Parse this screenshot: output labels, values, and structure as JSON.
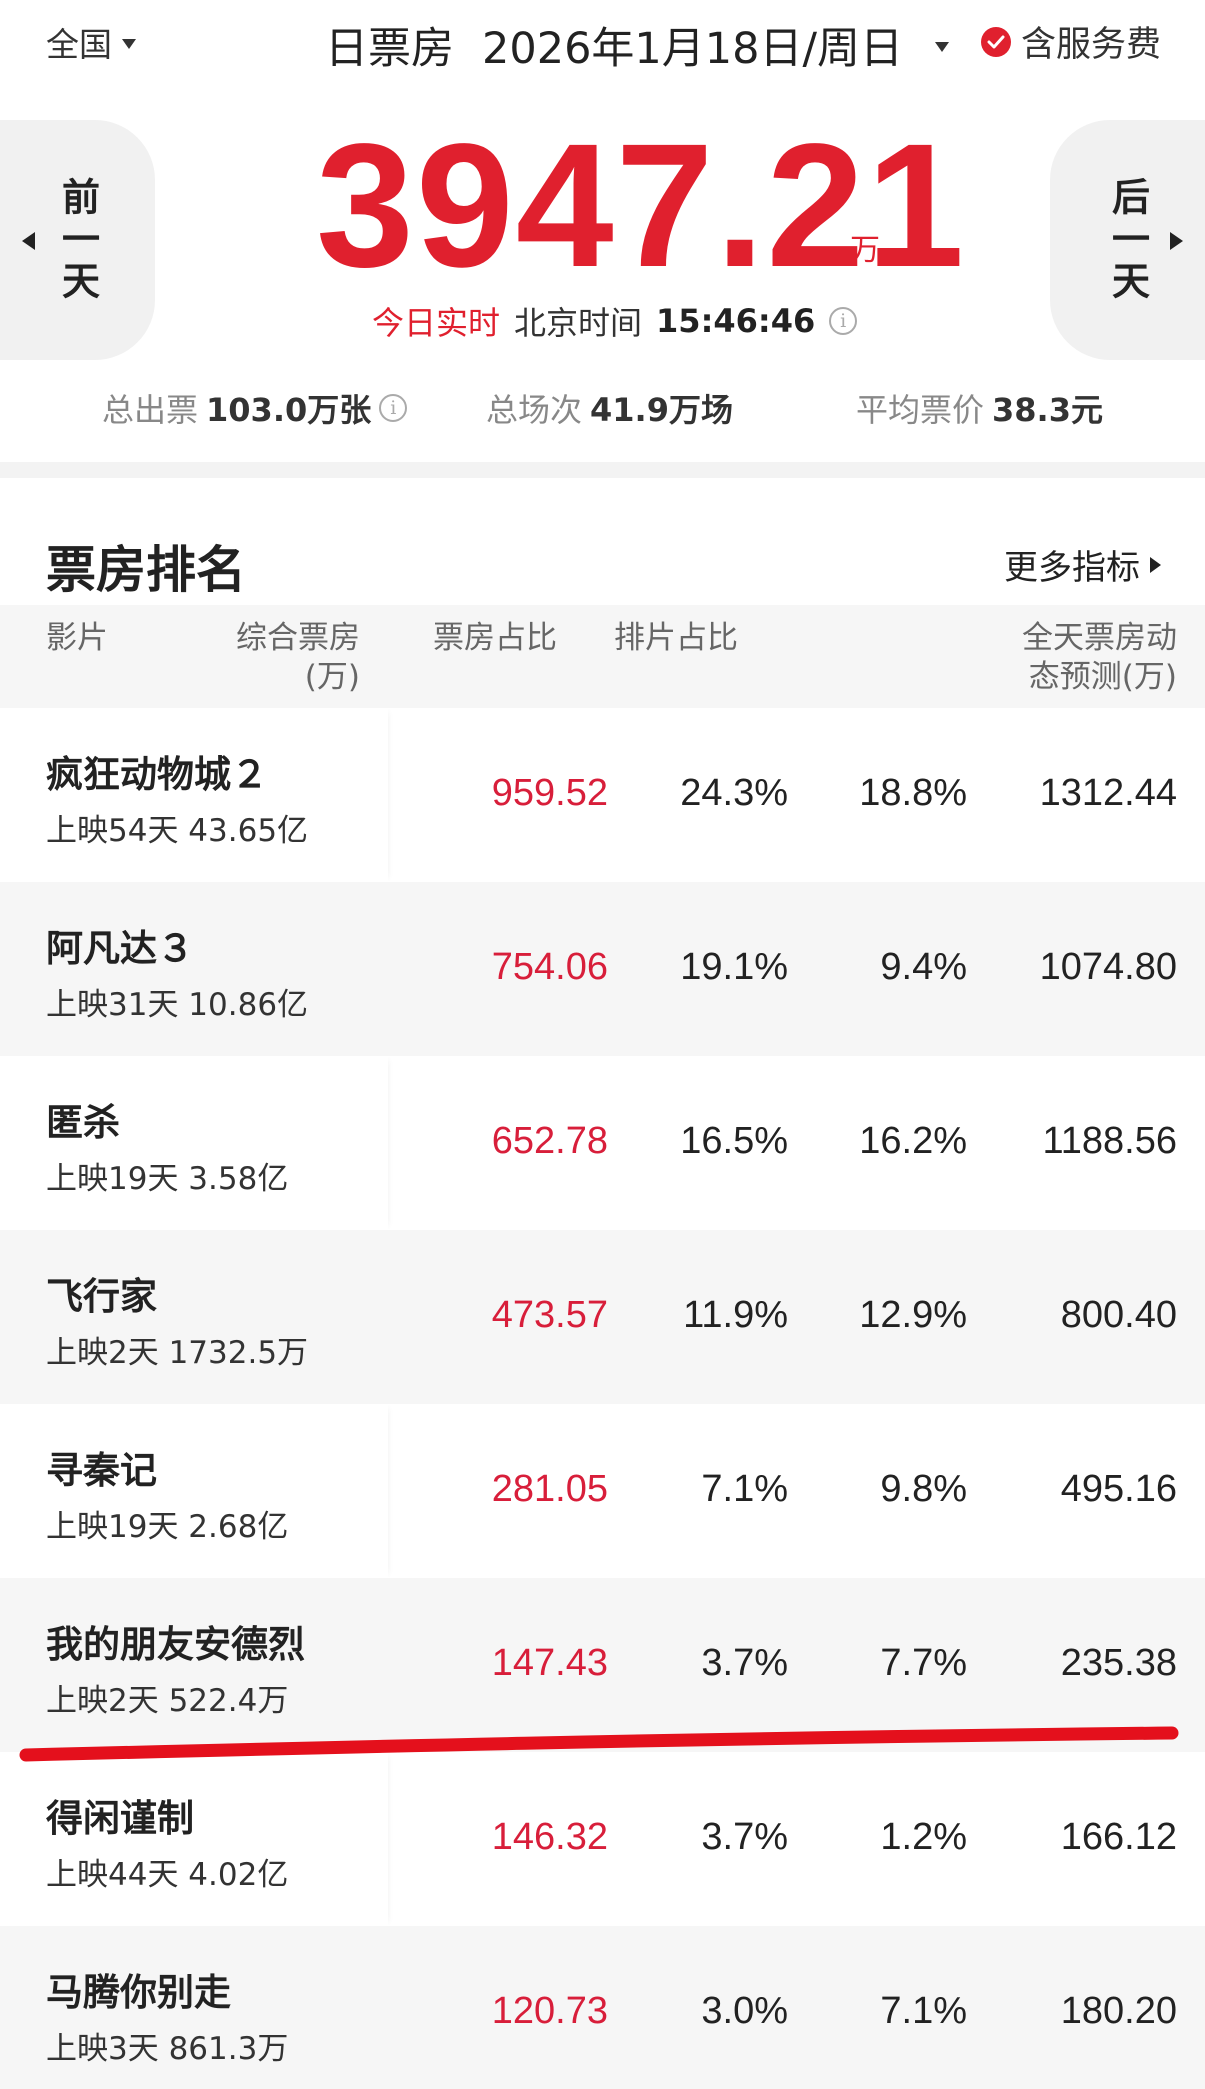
{
  "header": {
    "region": "全国",
    "title": "日票房",
    "date": "2026年1月18日/周日",
    "service_label": "含服务费"
  },
  "nav": {
    "prev_label": "前一天",
    "next_label": "后一天"
  },
  "hero": {
    "total": "3947.21",
    "unit": "万",
    "realtime_label": "今日实时",
    "beijing_label": "北京时间",
    "time": "15:46:46"
  },
  "stats": {
    "tickets_label": "总出票",
    "tickets_value": "103.0万张",
    "shows_label": "总场次",
    "shows_value": "41.9万场",
    "avg_label": "平均票价",
    "avg_value": "38.3元"
  },
  "ranking": {
    "title": "票房排名",
    "more_label": "更多指标",
    "columns": {
      "film": "影片",
      "box": "综合票房\n(万)",
      "box_share": "票房占比",
      "show_share": "排片占比",
      "forecast": "全天票房动\n态预测(万)"
    },
    "rows": [
      {
        "name": "疯狂动物城２",
        "sub": "上映54天 43.65亿",
        "box": "959.52",
        "box_share": "24.3%",
        "show_share": "18.8%",
        "forecast": "1312.44"
      },
      {
        "name": "阿凡达３",
        "sub": "上映31天 10.86亿",
        "box": "754.06",
        "box_share": "19.1%",
        "show_share": "9.4%",
        "forecast": "1074.80"
      },
      {
        "name": "匿杀",
        "sub": "上映19天 3.58亿",
        "box": "652.78",
        "box_share": "16.5%",
        "show_share": "16.2%",
        "forecast": "1188.56"
      },
      {
        "name": "飞行家",
        "sub": "上映2天 1732.5万",
        "box": "473.57",
        "box_share": "11.9%",
        "show_share": "12.9%",
        "forecast": "800.40"
      },
      {
        "name": "寻秦记",
        "sub": "上映19天 2.68亿",
        "box": "281.05",
        "box_share": "7.1%",
        "show_share": "9.8%",
        "forecast": "495.16"
      },
      {
        "name": "我的朋友安德烈",
        "sub": "上映2天 522.4万",
        "box": "147.43",
        "box_share": "3.7%",
        "show_share": "7.7%",
        "forecast": "235.38"
      },
      {
        "name": "得闲谨制",
        "sub": "上映44天 4.02亿",
        "box": "146.32",
        "box_share": "3.7%",
        "show_share": "1.2%",
        "forecast": "166.12"
      },
      {
        "name": "马腾你别走",
        "sub": "上映3天 861.3万",
        "box": "120.73",
        "box_share": "3.0%",
        "show_share": "7.1%",
        "forecast": "180.20"
      }
    ]
  },
  "colors": {
    "accent_red": "#e0202e",
    "box_red": "#d81e3a",
    "annotation_line": "#e4101c"
  },
  "icons": [
    "chevron-down-icon",
    "check-circle-icon",
    "info-icon",
    "arrow-left-icon",
    "arrow-right-icon"
  ]
}
